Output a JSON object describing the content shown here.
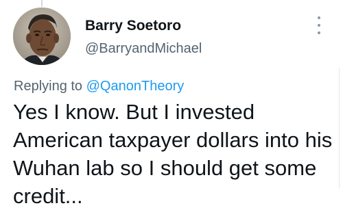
{
  "tweet": {
    "display_name": "Barry Soetoro",
    "handle": "@BarryandMichael",
    "replying_prefix": "Replying to",
    "replying_to": "@QanonTheory",
    "text": "Yes I know. But I invested American taxpayer dollars into his Wuhan lab so I should get some credit..."
  },
  "icons": {
    "more": "more-options-vertical-icon",
    "avatar": "profile-photo"
  },
  "colors": {
    "link": "#1d9bf0",
    "secondary_text": "#536471",
    "primary_text": "#0f1419",
    "background": "#ffffff"
  }
}
